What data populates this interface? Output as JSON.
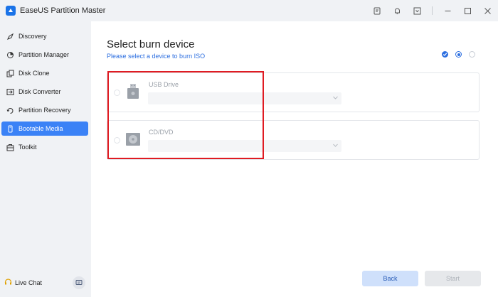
{
  "app": {
    "title": "EaseUS Partition Master"
  },
  "titlebar": {
    "icons": [
      "feedback-icon",
      "bell-icon",
      "dropdown-box-icon",
      "minimize-icon",
      "maximize-icon",
      "close-icon"
    ]
  },
  "sidebar": {
    "items": [
      {
        "label": "Discovery",
        "icon": "discovery-icon",
        "active": false
      },
      {
        "label": "Partition Manager",
        "icon": "partition-manager-icon",
        "active": false
      },
      {
        "label": "Disk Clone",
        "icon": "disk-clone-icon",
        "active": false
      },
      {
        "label": "Disk Converter",
        "icon": "disk-converter-icon",
        "active": false
      },
      {
        "label": "Partition Recovery",
        "icon": "partition-recovery-icon",
        "active": false
      },
      {
        "label": "Bootable Media",
        "icon": "bootable-media-icon",
        "active": true
      },
      {
        "label": "Toolkit",
        "icon": "toolkit-icon",
        "active": false
      }
    ],
    "live_chat": "Live Chat"
  },
  "main": {
    "title": "Select burn device",
    "subtitle": "Please select a device to burn ISO",
    "steps": [
      "done",
      "current",
      "pending"
    ],
    "devices": [
      {
        "name": "USB Drive",
        "icon": "usb-drive-icon",
        "selected_value": ""
      },
      {
        "name": "CD/DVD",
        "icon": "cd-dvd-icon",
        "selected_value": ""
      }
    ],
    "buttons": {
      "back": "Back",
      "start": "Start"
    }
  },
  "colors": {
    "accent": "#2d6fe0",
    "active_nav": "#3b82f6",
    "highlight_box": "#e01b22",
    "sidebar_bg": "#f0f2f5"
  }
}
